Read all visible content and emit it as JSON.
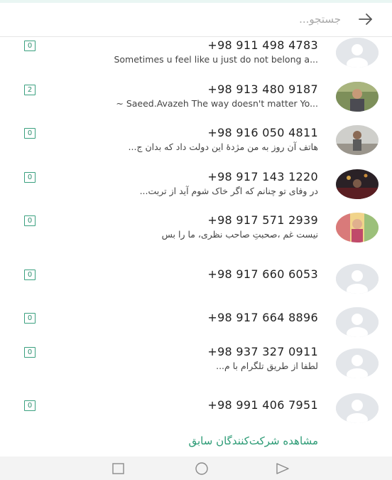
{
  "search": {
    "placeholder": "جستجو...",
    "back_icon": "arrow-right-icon"
  },
  "accent_color": "#2a9a74",
  "participants": [
    {
      "badge": "0",
      "phone": "+98 911 498 4783",
      "message": "Sometimes u feel like u just do not belong a...",
      "rtl": false,
      "avatar": "default-avatar"
    },
    {
      "badge": "2",
      "phone": "+98 913 480 9187",
      "message": "~ Saeed.Avazeh   The way doesn't matter Yo...",
      "rtl": false,
      "avatar": "photo-avatar"
    },
    {
      "badge": "0",
      "phone": "+98 916 050 4811",
      "message": "هاتف آن روز به من مژدهٔ این دولت داد  که بدان ج...",
      "rtl": true,
      "avatar": "photo-avatar"
    },
    {
      "badge": "0",
      "phone": "+98 917 143 1220",
      "message": "در وفای تو چنانم که اگر خاک شوم     آید از تربت...",
      "rtl": true,
      "avatar": "photo-avatar"
    },
    {
      "badge": "0",
      "phone": "+98 917 571 2939",
      "message": "نیست غم ،صحبتِ صاحب نظری، ما را بس",
      "rtl": true,
      "avatar": "photo-avatar"
    },
    {
      "badge": "0",
      "phone": "+98 917 660 6053",
      "message": "",
      "rtl": false,
      "avatar": "default-avatar"
    },
    {
      "badge": "0",
      "phone": "+98 917 664 8896",
      "message": "",
      "rtl": false,
      "avatar": "default-avatar"
    },
    {
      "badge": "0",
      "phone": "+98 937 327 0911",
      "message": "لطفا از طریق تلگرام با م...",
      "rtl": true,
      "avatar": "default-avatar"
    },
    {
      "badge": "0",
      "phone": "+98 991 406 7951",
      "message": "",
      "rtl": false,
      "avatar": "default-avatar"
    }
  ],
  "previous_participants_link": "مشاهده شرکت‌کنندگان سابق",
  "navbar": {
    "recent_icon": "square-icon",
    "home_icon": "circle-icon",
    "back_icon": "triangle-back-icon"
  }
}
